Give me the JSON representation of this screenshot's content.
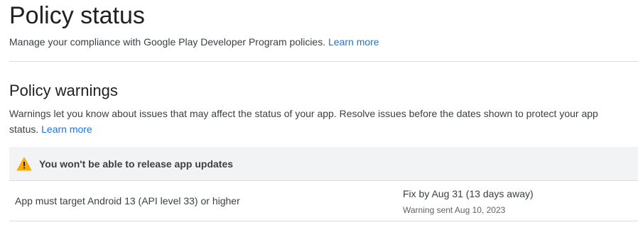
{
  "page": {
    "title": "Policy status",
    "subtitle": "Manage your compliance with Google Play Developer Program policies.",
    "subtitle_link": "Learn more"
  },
  "warnings": {
    "title": "Policy warnings",
    "description": "Warnings let you know about issues that may affect the status of your app. Resolve issues before the dates shown to protect your app status.",
    "description_link": "Learn more",
    "group": {
      "icon": "warning-triangle-icon",
      "icon_color": "#f9ab00",
      "title": "You won't be able to release app updates",
      "issues": [
        {
          "text": "App must target Android 13 (API level 33) or higher",
          "fix_by": "Fix by Aug 31 (13 days away)",
          "warning_sent": "Warning sent Aug 10, 2023"
        }
      ]
    }
  },
  "colors": {
    "link": "#1a73e8",
    "warning_bg": "#f1f3f4",
    "divider": "#dadce0"
  }
}
